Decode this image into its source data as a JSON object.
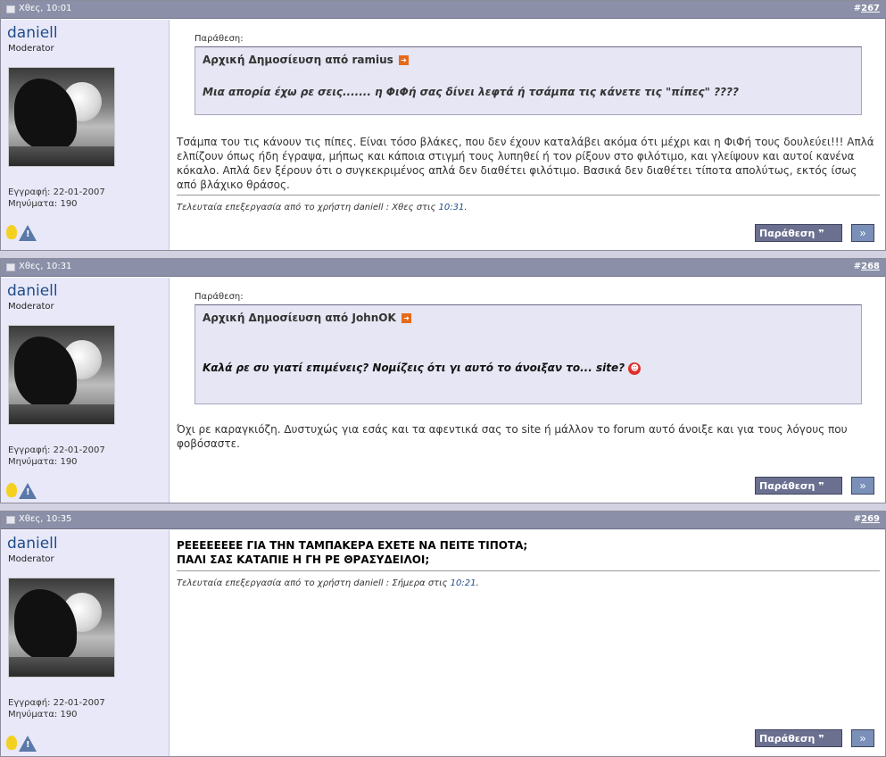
{
  "labels": {
    "quote": "Παράθεση:",
    "quote_button": "Παράθεση",
    "multi_quote": "»"
  },
  "posts": [
    {
      "date": "Χθες, 10:01",
      "number": "267",
      "user": {
        "name": "daniell",
        "title": "Moderator",
        "joined": "Εγγραφή: 22-01-2007",
        "posts": "Μηνύματα: 190"
      },
      "quote": {
        "head": "Αρχική Δημοσίευση από ramius",
        "text": "Μια απορία έχω ρε σεις....... η ΦιΦή σας δίνει λεφτά ή τσάμπα τις κάνετε τις \"πίπες\" ????"
      },
      "body": "Τσάμπα του τις κάνουν τις πίπες. Είναι τόσο βλάκες, που δεν έχουν καταλάβει ακόμα ότι μέχρι και η ΦιΦή τους δουλεύει!!! Απλά ελπίζουν όπως ήδη έγραψα, μήπως και κάποια στιγμή τους λυπηθεί ή τον ρίξουν στο φιλότιμο, και γλείψουν και αυτοί κανένα κόκαλο. Απλά δεν ξέρουν ότι ο συγκεκριμένος απλά δεν διαθέτει φιλότιμο. Βασικά δεν διαθέτει τίποτα απολύτως, εκτός ίσως από βλάχικο θράσος.",
      "edit": {
        "prefix": "Τελευταία επεξεργασία από το χρήστη daniell : Χθες στις",
        "time": "10:31",
        "suffix": "."
      }
    },
    {
      "date": "Χθες, 10:31",
      "number": "268",
      "user": {
        "name": "daniell",
        "title": "Moderator",
        "joined": "Εγγραφή: 22-01-2007",
        "posts": "Μηνύματα: 190"
      },
      "quote": {
        "head": "Αρχική Δημοσίευση από JohnOK",
        "text": "Καλά ρε συ γιατί επιμένεις? Νομίζεις ότι γι αυτό το άνοιξαν το... site?"
      },
      "body": "Όχι ρε καραγκιόζη. Δυστυχώς για εσάς και τα αφεντικά σας το site ή μάλλον το forum αυτό άνοιξε και για τους λόγους που φοβόσαστε."
    },
    {
      "date": "Χθες, 10:35",
      "number": "269",
      "user": {
        "name": "daniell",
        "title": "Moderator",
        "joined": "Εγγραφή: 22-01-2007",
        "posts": "Μηνύματα: 190"
      },
      "body_lines": [
        "ΡΕΕΕΕΕΕΕΕ ΓΙΑ ΤΗΝ ΤΑΜΠΑΚΕΡΑ ΕΧΕΤΕ ΝΑ ΠΕΙΤΕ ΤΙΠΟΤΑ;",
        "ΠΑΛΙ ΣΑΣ ΚΑΤΑΠΙΕ Η ΓΗ ΡΕ ΘΡΑΣΥΔΕΙΛΟΙ;"
      ],
      "edit": {
        "prefix": "Τελευταία επεξεργασία από το χρήστη daniell : Σήμερα στις",
        "time": "10:21",
        "suffix": "."
      }
    }
  ]
}
